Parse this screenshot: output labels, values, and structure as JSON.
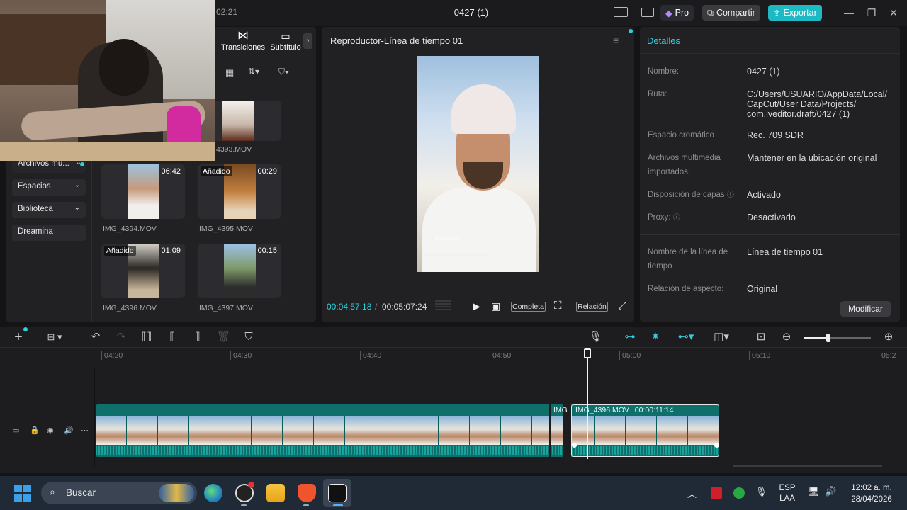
{
  "window": {
    "time": "02:21",
    "project_title": "0427 (1)",
    "pro_label": "Pro",
    "share_label": "Compartir",
    "export_label": "Exportar"
  },
  "media": {
    "tabs": [
      {
        "label": "Transiciones",
        "icon": "transition-icon"
      },
      {
        "label": "Subtítulo",
        "icon": "subtitle-icon"
      }
    ],
    "nav": [
      "Archivos mu...",
      "Espacios",
      "Biblioteca",
      "Dreamina"
    ],
    "items": [
      {
        "name": "4393.MOV",
        "duration": "",
        "badge": ""
      },
      {
        "name": "IMG_4394.MOV",
        "duration": "06:42",
        "badge": ""
      },
      {
        "name": "IMG_4395.MOV",
        "duration": "00:29",
        "badge": "Añadido"
      },
      {
        "name": "IMG_4396.MOV",
        "duration": "01:09",
        "badge": "Añadido"
      },
      {
        "name": "IMG_4397.MOV",
        "duration": "00:15",
        "badge": ""
      }
    ]
  },
  "player": {
    "title": "Reproductor-Línea de tiempo 01",
    "current_time": "00:04:57:18",
    "total_time": "00:05:07:24",
    "full_label": "Completa",
    "ratio_label": "Relación",
    "overlay_name": "@Your name",
    "overlay_desc": "Here are some descriptions about videos"
  },
  "details": {
    "title": "Detalles",
    "fields": [
      {
        "label": "Nombre:",
        "value": "0427 (1)"
      },
      {
        "label": "Ruta:",
        "value": "C:/Users/USUARIO/AppData/Local/ CapCut/User Data/Projects/ com.lveditor.draft/0427 (1)"
      },
      {
        "label": "Espacio cromático",
        "value": "Rec. 709 SDR"
      },
      {
        "label": "Archivos multimedia importados:",
        "value": "Mantener en la ubicación original"
      },
      {
        "label": "Disposición de capas",
        "value": "Activado"
      },
      {
        "label": "Proxy:",
        "value": "Desactivado"
      },
      {
        "label": "Nombre de la línea de tiempo",
        "value": "Línea de tiempo 01"
      },
      {
        "label": "Relación de aspecto:",
        "value": "Original"
      }
    ],
    "modify_label": "Modificar"
  },
  "timeline": {
    "ticks": [
      "04:20",
      "04:30",
      "04:40",
      "04:50",
      "05:00",
      "05:10",
      "05:2"
    ],
    "clip1_label": "IMG",
    "clip2_name": "IMG_4396.MOV",
    "clip2_duration": "00:00:11:14",
    "zoom_level": 0.37
  },
  "taskbar": {
    "search_label": "Buscar",
    "lang": "ESP",
    "layout": "LAA",
    "clock_time": "12:02 a. m.",
    "clock_date": "28/04/2026"
  },
  "colors": {
    "accent": "#1fb9c4",
    "track": "#0e6f6b"
  }
}
